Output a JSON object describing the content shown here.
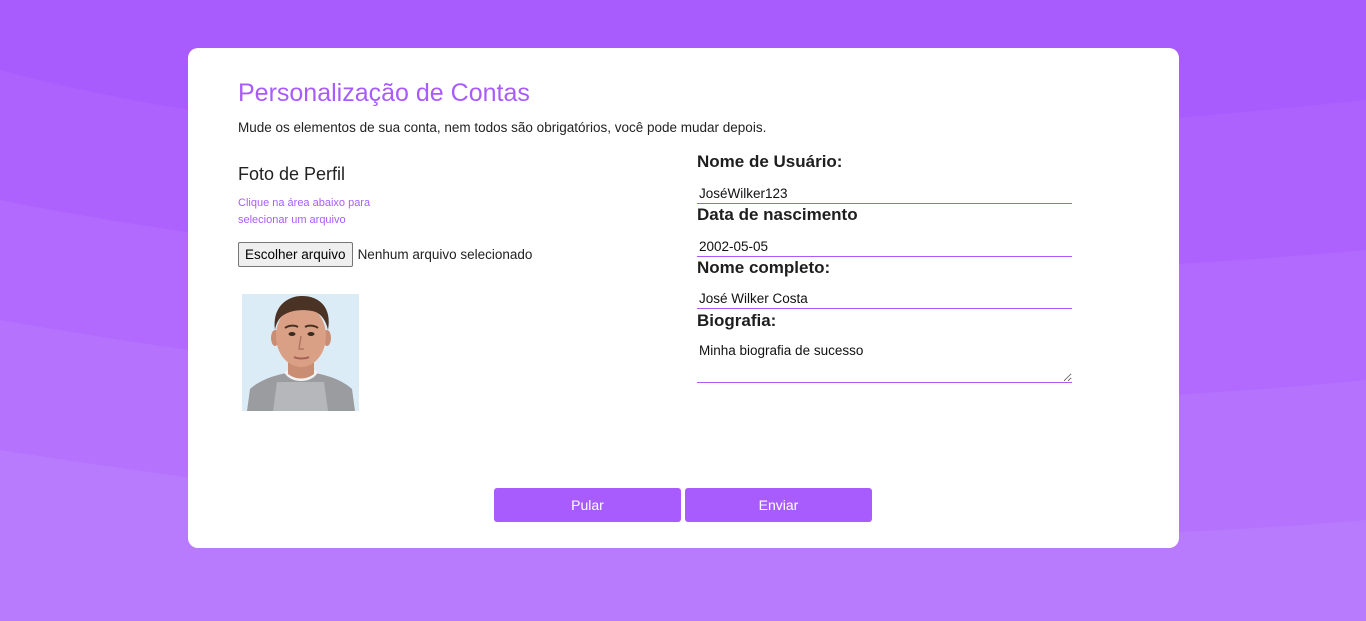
{
  "colors": {
    "accent": "#a95cfd",
    "background": "#a95cfd",
    "card": "#ffffff"
  },
  "header": {
    "title": "Personalização de Contas",
    "subtitle": "Mude os elementos de sua conta, nem todos são obrigatórios, você pode mudar depois."
  },
  "profile_photo": {
    "heading": "Foto de Perfil",
    "hint_line1": "Clique na área abaixo para",
    "hint_line2": "selecionar um arquivo",
    "file_button_label": "Escolher arquivo",
    "file_status": "Nenhum arquivo selecionado",
    "avatar_alt": "profile-photo"
  },
  "form": {
    "username": {
      "label": "Nome de Usuário:",
      "value": "JoséWilker123"
    },
    "birthdate": {
      "label": "Data de nascimento",
      "value": "2002-05-05"
    },
    "fullname": {
      "label": "Nome completo:",
      "value": "José Wilker Costa"
    },
    "bio": {
      "label": "Biografia:",
      "value": "Minha biografia de sucesso"
    }
  },
  "actions": {
    "skip_label": "Pular",
    "submit_label": "Enviar"
  }
}
